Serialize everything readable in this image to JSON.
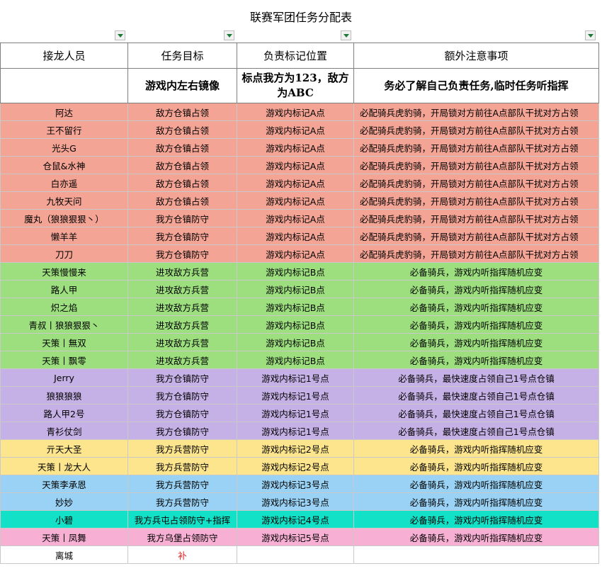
{
  "sheet": {
    "title": "联赛军团任务分配表",
    "headers": [
      "接龙人员",
      "任务目标",
      "负责标记位置",
      "额外注意事项"
    ],
    "subheaders": [
      "",
      "游戏内左右镜像",
      "标点我方为123，敌方为ABC",
      "务必了解自己负责任务,临时任务听指挥"
    ],
    "rows": [
      {
        "c": [
          "阿达",
          "敌方仓镇占领",
          "游戏内标记A点",
          "必配骑兵虎豹骑，开局锁对方前往A点部队干扰对方占领"
        ],
        "color": "red"
      },
      {
        "c": [
          "王不留行",
          "敌方仓镇占领",
          "游戏内标记A点",
          "必配骑兵虎豹骑，开局锁对方前往A点部队干扰对方占领"
        ],
        "color": "red"
      },
      {
        "c": [
          "光头G",
          "敌方仓镇占领",
          "游戏内标记A点",
          "必配骑兵虎豹骑，开局锁对方前往A点部队干扰对方占领"
        ],
        "color": "red"
      },
      {
        "c": [
          "仓鼠&水神",
          "敌方仓镇占领",
          "游戏内标记A点",
          "必配骑兵虎豹骑，开局锁对方前往A点部队干扰对方占领"
        ],
        "color": "red"
      },
      {
        "c": [
          "白亦遥",
          "敌方仓镇占领",
          "游戏内标记A点",
          "必配骑兵虎豹骑，开局锁对方前往A点部队干扰对方占领"
        ],
        "color": "red"
      },
      {
        "c": [
          "九牧天问",
          "敌方仓镇占领",
          "游戏内标记A点",
          "必配骑兵虎豹骑，开局锁对方前往A点部队干扰对方占领"
        ],
        "color": "red"
      },
      {
        "c": [
          "魔丸（狼狼狠狠丶）",
          "我方仓镇防守",
          "游戏内标记A点",
          "必配骑兵虎豹骑，开局锁对方前往A点部队干扰对方占领"
        ],
        "color": "red"
      },
      {
        "c": [
          "懒羊羊",
          "我方仓镇防守",
          "游戏内标记A点",
          "必配骑兵虎豹骑，开局锁对方前往A点部队干扰对方占领"
        ],
        "color": "red"
      },
      {
        "c": [
          "刀刀",
          "我方仓镇防守",
          "游戏内标记A点",
          "必配骑兵虎豹骑，开局锁对方前往A点部队干扰对方占领"
        ],
        "color": "red"
      },
      {
        "c": [
          "天策慢慢来",
          "进攻敌方兵营",
          "游戏内标记B点",
          "必备骑兵，游戏内听指挥随机应变"
        ],
        "color": "green"
      },
      {
        "c": [
          "路人甲",
          "进攻敌方兵营",
          "游戏内标记B点",
          "必备骑兵，游戏内听指挥随机应变"
        ],
        "color": "green"
      },
      {
        "c": [
          "炽之焰",
          "进攻敌方兵营",
          "游戏内标记B点",
          "必备骑兵，游戏内听指挥随机应变"
        ],
        "color": "green"
      },
      {
        "c": [
          "青叔丨狼狼狠狠丶",
          "进攻敌方兵营",
          "游戏内标记B点",
          "必备骑兵，游戏内听指挥随机应变"
        ],
        "color": "green"
      },
      {
        "c": [
          "天策丨無双",
          "进攻敌方兵营",
          "游戏内标记B点",
          "必备骑兵，游戏内听指挥随机应变"
        ],
        "color": "green"
      },
      {
        "c": [
          "天策丨飘零",
          "进攻敌方兵营",
          "游戏内标记B点",
          "必备骑兵，游戏内听指挥随机应变"
        ],
        "color": "green"
      },
      {
        "c": [
          "Jerry",
          "我方仓镇防守",
          "游戏内标记1号点",
          "必备骑兵，最快速度占领自己1号点仓镇"
        ],
        "color": "purple"
      },
      {
        "c": [
          "狼狼狼狼",
          "我方仓镇防守",
          "游戏内标记1号点",
          "必备骑兵，最快速度占领自己1号点仓镇"
        ],
        "color": "purple"
      },
      {
        "c": [
          "路人甲2号",
          "我方仓镇防守",
          "游戏内标记1号点",
          "必备骑兵，最快速度占领自己1号点仓镇"
        ],
        "color": "purple"
      },
      {
        "c": [
          "青衫仗剑",
          "我方仓镇防守",
          "游戏内标记1号点",
          "必备骑兵，最快速度占领自己1号点仓镇"
        ],
        "color": "purple"
      },
      {
        "c": [
          "亓天大圣",
          "我方兵营防守",
          "游戏内标记2号点",
          "必备骑兵，游戏内听指挥随机应变"
        ],
        "color": "yellow"
      },
      {
        "c": [
          "天策丨龙大人",
          "我方兵营防守",
          "游戏内标记2号点",
          "必备骑兵，游戏内听指挥随机应变"
        ],
        "color": "yellow"
      },
      {
        "c": [
          "天策李承恩",
          "我方兵营防守",
          "游戏内标记3号点",
          "必备骑兵，游戏内听指挥随机应变"
        ],
        "color": "blue"
      },
      {
        "c": [
          "妙妙",
          "我方兵营防守",
          "游戏内标记3号点",
          "必备骑兵，游戏内听指挥随机应变"
        ],
        "color": "blue"
      },
      {
        "c": [
          "小碧",
          "我方兵屯占领防守+指挥",
          "游戏内标记4号点",
          "必备骑兵，游戏内听指挥随机应变"
        ],
        "color": "teal"
      },
      {
        "c": [
          "天策丨凤舞",
          "我方乌堡占领防守",
          "游戏内标记5号点",
          "必备骑兵，游戏内听指挥随机应变"
        ],
        "color": "pink"
      },
      {
        "c": [
          "离城",
          "补",
          "",
          ""
        ],
        "color": "white"
      }
    ]
  }
}
